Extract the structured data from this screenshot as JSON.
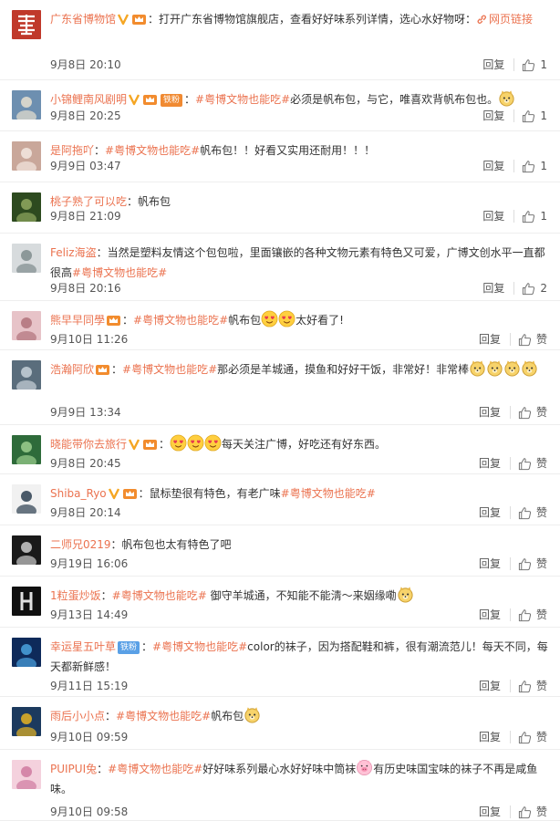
{
  "comments": [
    {
      "user": "广东省博物馆",
      "badges": [
        "verified-v",
        "fan-crown"
      ],
      "segments": [
        {
          "t": "text",
          "v": "：打开广东省博物馆旗舰店，查看好好味系列详情，选心水好物呀："
        },
        {
          "t": "weblink",
          "v": "网页链接"
        }
      ],
      "time": "9月8日 20:10",
      "reply": "回复",
      "likes": "1"
    },
    {
      "user": "小锦鲤南风剧明",
      "badges": [
        "verified-v",
        "fan-crown",
        "fan-label-orange"
      ],
      "fan_label": "铁粉",
      "segments": [
        {
          "t": "text",
          "v": "："
        },
        {
          "t": "tag",
          "v": "#粤博文物也能吃#"
        },
        {
          "t": "text",
          "v": "必须是帆布包，与它，唯喜欢背帆布包也。"
        },
        {
          "t": "emoji",
          "v": "doge"
        }
      ],
      "time": "9月8日 20:25",
      "reply": "回复",
      "likes": "1"
    },
    {
      "user": "是阿拖吖",
      "badges": [],
      "segments": [
        {
          "t": "text",
          "v": "："
        },
        {
          "t": "tag",
          "v": "#粤博文物也能吃#"
        },
        {
          "t": "text",
          "v": "帆布包！！好看又实用还耐用！！！"
        }
      ],
      "time": "9月9日 03:47",
      "reply": "回复",
      "likes": "1"
    },
    {
      "user": "桃子熟了可以吃",
      "badges": [],
      "segments": [
        {
          "t": "text",
          "v": "：帆布包"
        }
      ],
      "time": "9月8日 21:09",
      "reply": "回复",
      "likes": "1"
    },
    {
      "user": "Feliz海盗",
      "badges": [],
      "segments": [
        {
          "t": "text",
          "v": "：当然是塑料友情这个包包啦，里面镶嵌的各种文物元素有特色又可爱，广博文创水平一直都很高"
        },
        {
          "t": "tag",
          "v": "#粤博文物也能吃#"
        }
      ],
      "time": "9月8日 20:16",
      "reply": "回复",
      "likes": "2"
    },
    {
      "user": "熊早早同學",
      "badges": [
        "fan-crown"
      ],
      "segments": [
        {
          "t": "text",
          "v": "："
        },
        {
          "t": "tag",
          "v": "#粤博文物也能吃#"
        },
        {
          "t": "text",
          "v": "帆布包"
        },
        {
          "t": "emoji",
          "v": "heart-eyes"
        },
        {
          "t": "emoji",
          "v": "heart-eyes"
        },
        {
          "t": "text",
          "v": "太好看了!"
        }
      ],
      "time": "9月10日 11:26",
      "reply": "回复",
      "likes": "赞"
    },
    {
      "user": "浩瀚阿欣",
      "badges": [
        "fan-crown"
      ],
      "segments": [
        {
          "t": "text",
          "v": "："
        },
        {
          "t": "tag",
          "v": "#粤博文物也能吃#"
        },
        {
          "t": "text",
          "v": "那必须是羊城通，摸鱼和好好干饭，非常好！非常棒"
        },
        {
          "t": "emoji",
          "v": "doge"
        },
        {
          "t": "emoji",
          "v": "doge"
        },
        {
          "t": "emoji",
          "v": "doge"
        },
        {
          "t": "emoji",
          "v": "doge"
        }
      ],
      "time": "9月9日 13:34",
      "reply": "回复",
      "likes": "赞"
    },
    {
      "user": "晓能带你去旅行",
      "badges": [
        "verified-v",
        "fan-crown"
      ],
      "segments": [
        {
          "t": "text",
          "v": "："
        },
        {
          "t": "emoji",
          "v": "heart-eyes"
        },
        {
          "t": "emoji",
          "v": "heart-eyes"
        },
        {
          "t": "emoji",
          "v": "heart-eyes"
        },
        {
          "t": "text",
          "v": "每天关注广博，好吃还有好东西。"
        }
      ],
      "time": "9月8日 20:45",
      "reply": "回复",
      "likes": "赞"
    },
    {
      "user": "Shiba_Ryo",
      "badges": [
        "verified-v",
        "fan-crown"
      ],
      "segments": [
        {
          "t": "text",
          "v": "：鼠标垫很有特色，有老广味"
        },
        {
          "t": "tag",
          "v": "#粤博文物也能吃#"
        }
      ],
      "time": "9月8日 20:14",
      "reply": "回复",
      "likes": "赞"
    },
    {
      "user": "二师兄0219",
      "badges": [],
      "segments": [
        {
          "t": "text",
          "v": "：帆布包也太有特色了吧"
        }
      ],
      "time": "9月19日 16:06",
      "reply": "回复",
      "likes": "赞"
    },
    {
      "user": "1粒蛋炒饭",
      "badges": [],
      "segments": [
        {
          "t": "text",
          "v": "："
        },
        {
          "t": "tag",
          "v": "#粤博文物也能吃#"
        },
        {
          "t": "text",
          "v": " 御守羊城通，不知能不能淸～来姻缘嘞"
        },
        {
          "t": "emoji",
          "v": "doge"
        }
      ],
      "time": "9月13日 14:49",
      "reply": "回复",
      "likes": "赞"
    },
    {
      "user": "幸运星五叶草",
      "badges": [
        "fan-label-blue"
      ],
      "fan_label": "铁粉",
      "segments": [
        {
          "t": "text",
          "v": "："
        },
        {
          "t": "tag",
          "v": "#粤博文物也能吃#"
        },
        {
          "t": "text",
          "v": "color的袜子，因为搭配鞋和裤，很有潮流范儿！每天不同，每天都新鲜感！"
        }
      ],
      "time": "9月11日 15:19",
      "reply": "回复",
      "likes": "赞"
    },
    {
      "user": "雨后小小点",
      "badges": [],
      "segments": [
        {
          "t": "text",
          "v": "："
        },
        {
          "t": "tag",
          "v": "#粤博文物也能吃#"
        },
        {
          "t": "text",
          "v": "帆布包"
        },
        {
          "t": "emoji",
          "v": "doge"
        }
      ],
      "time": "9月10日 09:59",
      "reply": "回复",
      "likes": "赞"
    },
    {
      "user": "PUIPUI兔",
      "badges": [],
      "segments": [
        {
          "t": "text",
          "v": "："
        },
        {
          "t": "tag",
          "v": "#粤博文物也能吃#"
        },
        {
          "t": "text",
          "v": "好好味系列最心水好好味中筒袜"
        },
        {
          "t": "emoji",
          "v": "pig"
        },
        {
          "t": "text",
          "v": "有历史味国宝味的袜子不再是咸鱼味。"
        }
      ],
      "time": "9月10日 09:58",
      "reply": "回复",
      "likes": "赞"
    }
  ],
  "colors": {
    "username": "#eb7350",
    "topic": "#eb7350",
    "text": "#333333",
    "meta": "#555555",
    "verified": "#f5a623",
    "fan_blue": "#5aa0e6"
  }
}
